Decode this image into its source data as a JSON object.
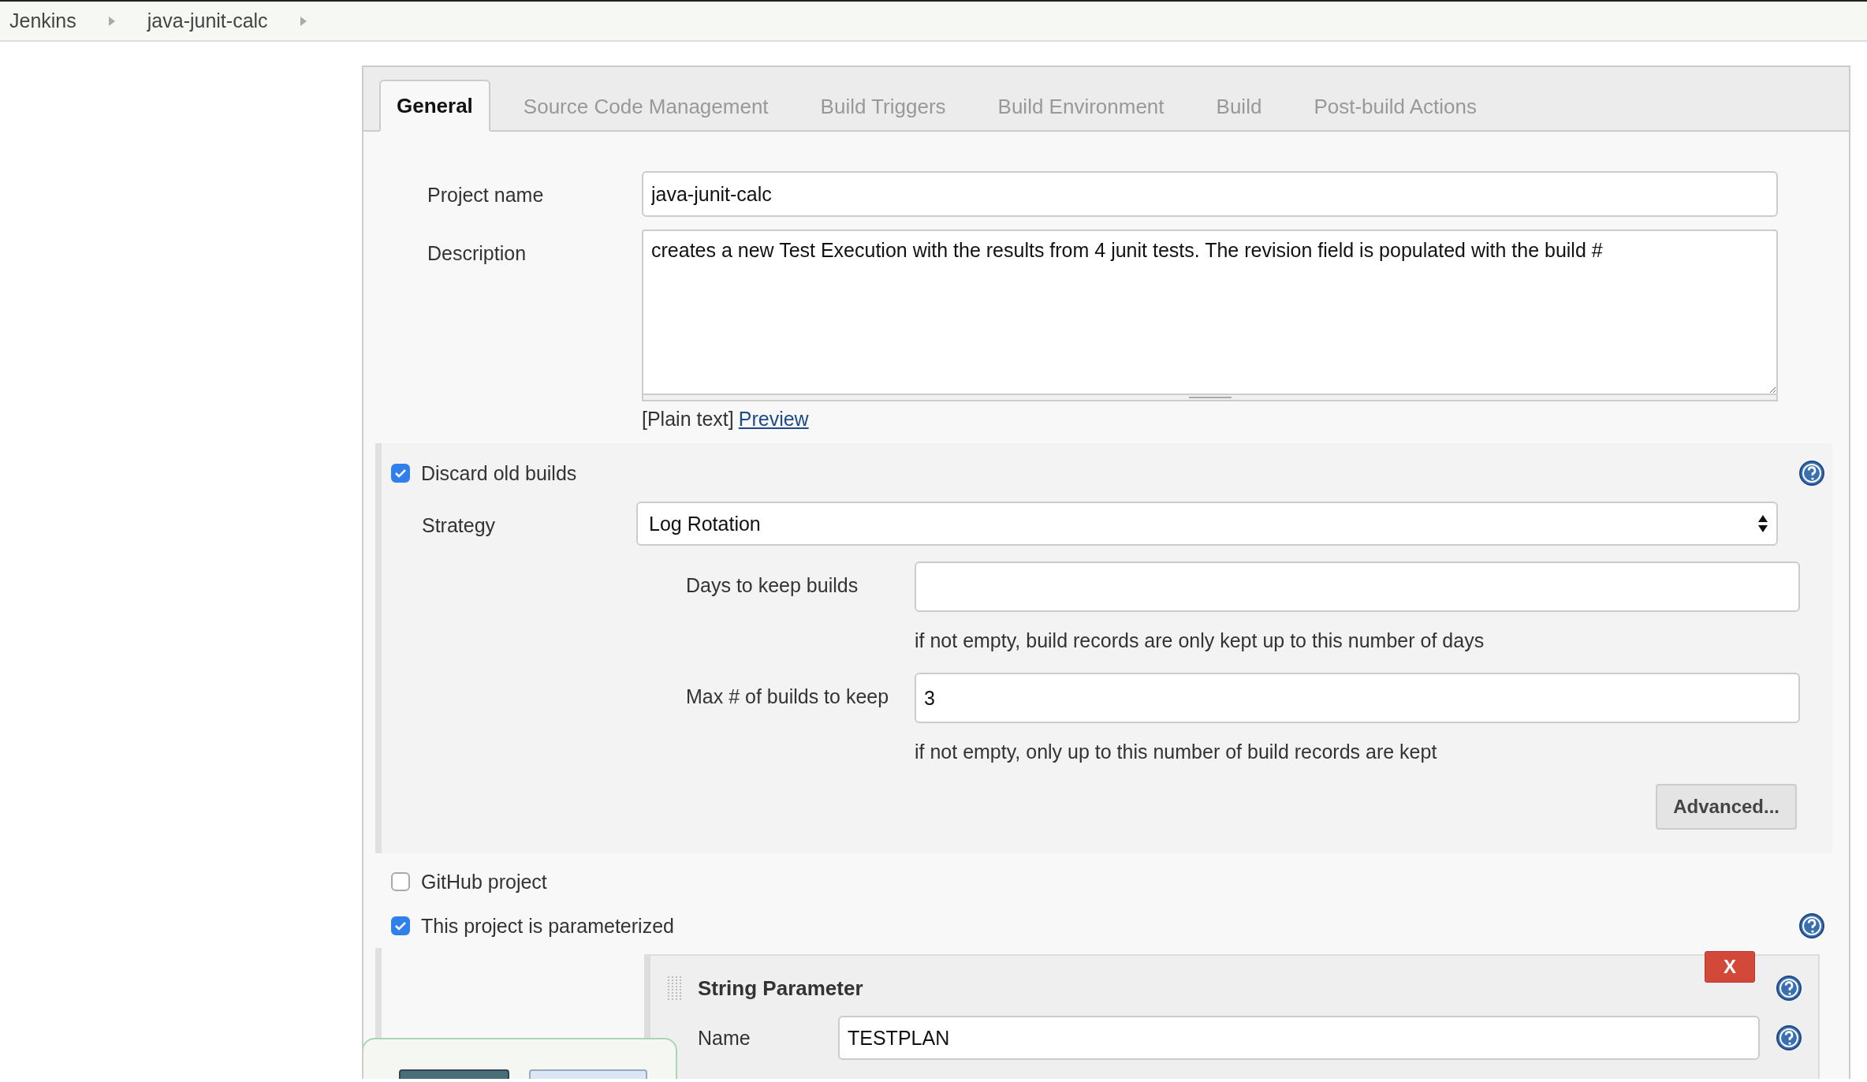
{
  "breadcrumbs": [
    "Jenkins",
    "java-junit-calc"
  ],
  "tabs": [
    {
      "label": "General",
      "selected": true
    },
    {
      "label": "Source Code Management",
      "selected": false
    },
    {
      "label": "Build Triggers",
      "selected": false
    },
    {
      "label": "Build Environment",
      "selected": false
    },
    {
      "label": "Build",
      "selected": false
    },
    {
      "label": "Post-build Actions",
      "selected": false
    }
  ],
  "project_name": {
    "label": "Project name",
    "value": "java-junit-calc"
  },
  "description": {
    "label": "Description",
    "value": "creates a new Test Execution with the results from 4 junit tests. The revision field is populated with the build #",
    "format": "[Plain text]",
    "preview_link": "Preview"
  },
  "discard_old_builds": {
    "label": "Discard old builds",
    "checked": true,
    "strategy": {
      "label": "Strategy",
      "value": "Log Rotation"
    },
    "fields": [
      {
        "label": "Days to keep builds",
        "help": "if not empty, build records are only kept up to this number of days"
      },
      {
        "label": "Max # of builds to keep",
        "value": "3",
        "help": "if not empty, only up to this number of build records are kept"
      }
    ],
    "advanced_button": "Advanced..."
  },
  "github_project": {
    "label": "GitHub project",
    "checked": false
  },
  "parameterized": {
    "label": "This project is parameterized",
    "checked": true
  },
  "string_parameter": {
    "title": "String Parameter",
    "delete_button": "X",
    "name_label": "Name",
    "name_value": "TESTPLAN"
  }
}
